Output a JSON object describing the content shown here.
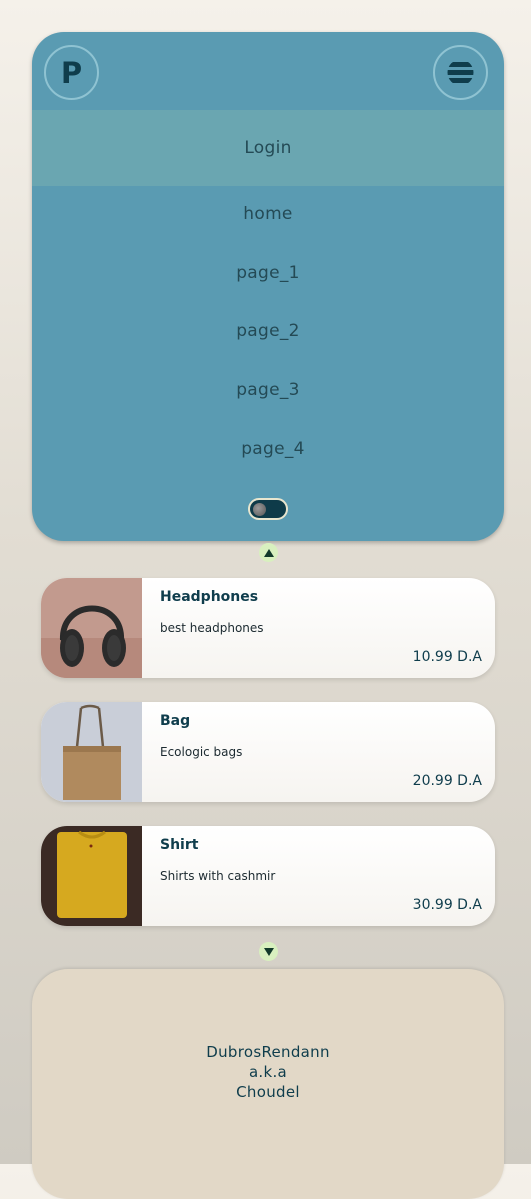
{
  "header": {
    "logo_letter": "P",
    "menu_icon": "menu-icon"
  },
  "nav": {
    "login_label": "Login",
    "links": [
      "home",
      "page_1",
      "page_2",
      "page_3",
      "page_4"
    ],
    "theme_toggle": {
      "on": false
    }
  },
  "products": [
    {
      "title": "Headphones",
      "description": "best headphones",
      "price": "10.99 D.A",
      "image": "headphones-image"
    },
    {
      "title": "Bag",
      "description": "Ecologic bags",
      "price": "20.99 D.A",
      "image": "bag-image"
    },
    {
      "title": "Shirt",
      "description": "Shirts with cashmir",
      "price": "30.99 D.A",
      "image": "shirt-image"
    }
  ],
  "footer": {
    "lines": [
      "DubrosRendann",
      "a.k.a",
      "Choudel"
    ]
  },
  "colors": {
    "nav_bg": "#5a9bb2",
    "login_bg": "#6aa6b1",
    "text_dark": "#0f3d4c",
    "arrow_bg": "#d8f0bf",
    "footer_bg": "#e2d8c7"
  }
}
